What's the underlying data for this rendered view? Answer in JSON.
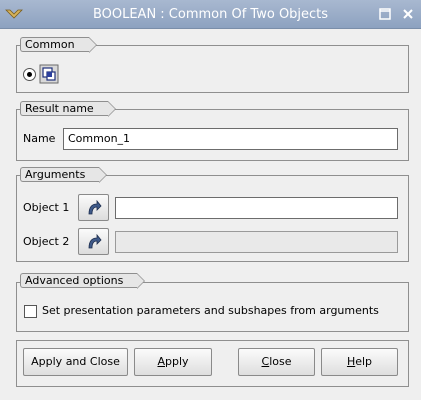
{
  "window": {
    "title": "BOOLEAN : Common Of Two Objects"
  },
  "common_group": {
    "label": "Common"
  },
  "result_group": {
    "label": "Result name",
    "name_label": "Name",
    "name_value": "Common_1"
  },
  "arguments_group": {
    "label": "Arguments",
    "object1_label": "Object 1",
    "object1_value": "",
    "object2_label": "Object 2",
    "object2_value": ""
  },
  "advanced_group": {
    "label": "Advanced options",
    "checkbox_label": "Set presentation parameters and subshapes from arguments",
    "checked": false
  },
  "buttons": {
    "apply_close": "Apply and Close",
    "apply_first": "A",
    "apply_rest": "pply",
    "close_first": "C",
    "close_rest": "lose",
    "help_first": "H",
    "help_rest": "elp"
  },
  "colors": {
    "titlebar": "#96a8c4",
    "window_bg": "#efefef"
  },
  "icons": [
    "app-icon",
    "maximize-icon",
    "close-icon",
    "common-operation-icon",
    "selection-arrow-icon"
  ]
}
